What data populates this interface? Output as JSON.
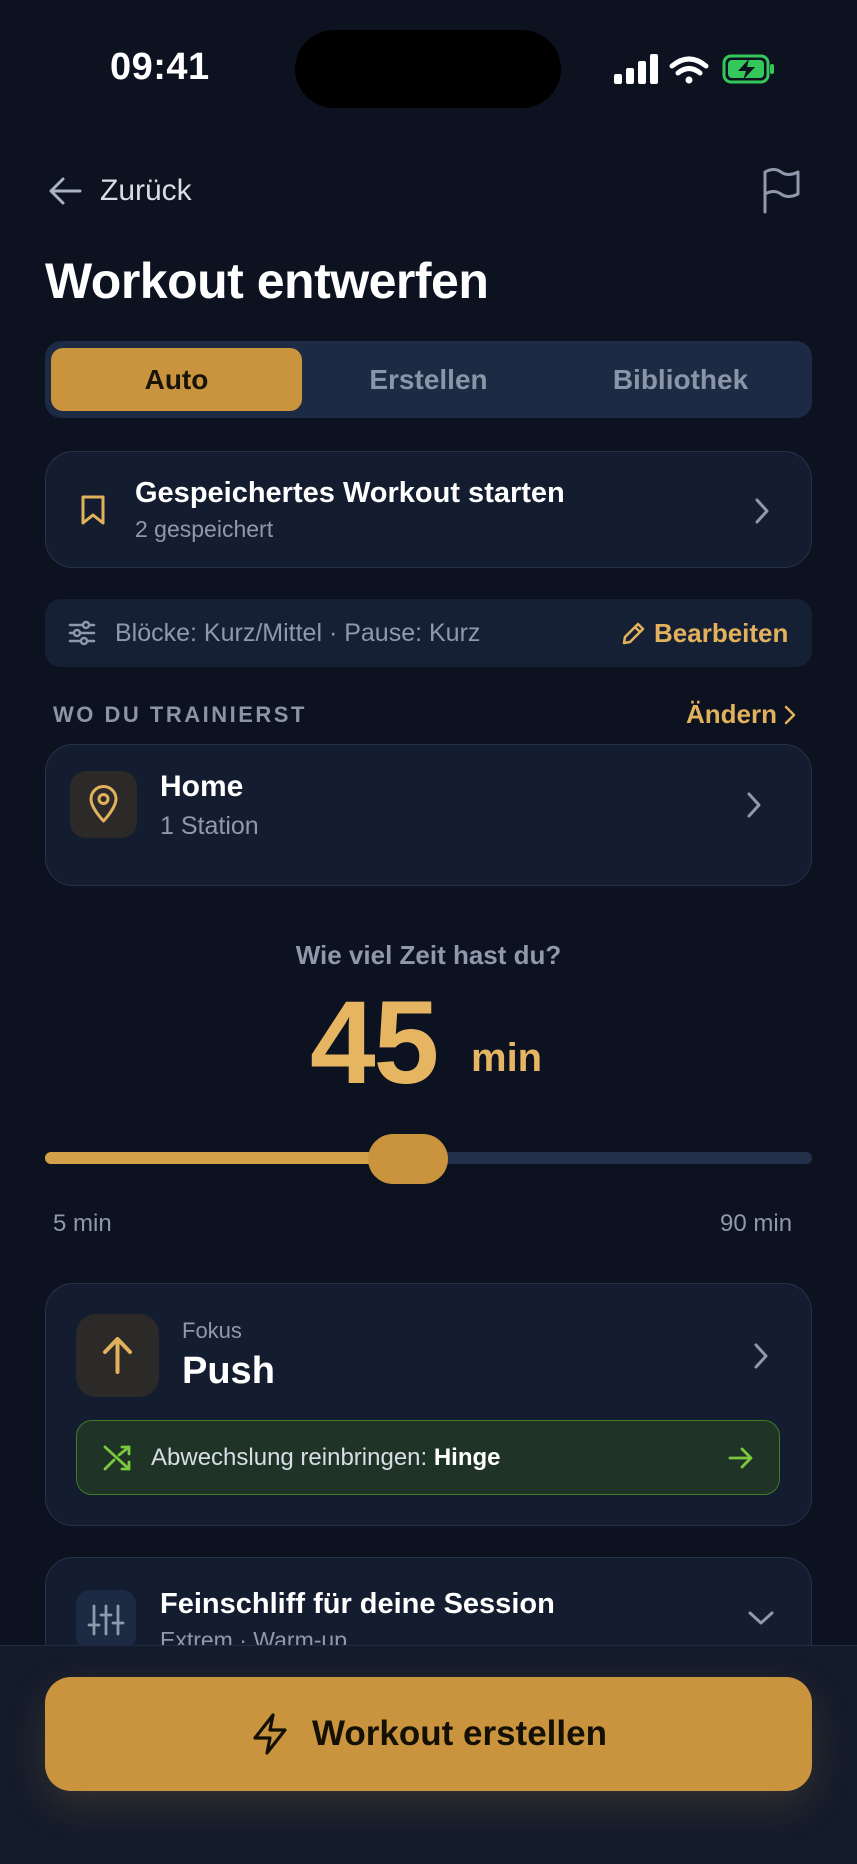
{
  "status_bar": {
    "time": "09:41"
  },
  "nav": {
    "back_label": "Zurück"
  },
  "page": {
    "title": "Workout entwerfen"
  },
  "tabs": [
    {
      "label": "Auto",
      "active": true
    },
    {
      "label": "Erstellen",
      "active": false
    },
    {
      "label": "Bibliothek",
      "active": false
    }
  ],
  "saved_workout": {
    "title": "Gespeichertes Workout starten",
    "subtitle": "2 gespeichert"
  },
  "settings": {
    "summary": "Blöcke: Kurz/Mittel · Pause: Kurz",
    "edit_label": "Bearbeiten"
  },
  "location": {
    "section_label": "WO DU TRAINIERST",
    "change_label": "Ändern",
    "name": "Home",
    "stations": "1 Station"
  },
  "time": {
    "question": "Wie viel Zeit hast du?",
    "value": "45",
    "unit": "min",
    "min_label": "5 min",
    "max_label": "90 min",
    "min": 5,
    "max": 90,
    "current": 45
  },
  "focus": {
    "label": "Fokus",
    "value": "Push",
    "variety_prefix": "Abwechslung reinbringen: ",
    "variety_target": "Hinge"
  },
  "fine_tune": {
    "title": "Feinschliff für deine Session",
    "subtitle": "Extrem · Warm-up"
  },
  "cta": {
    "label": "Workout erstellen"
  },
  "colors": {
    "background": "#0c1220",
    "accent": "#c9943d",
    "accent_text": "#e2b15c",
    "variety_green": "#7bc83c"
  }
}
